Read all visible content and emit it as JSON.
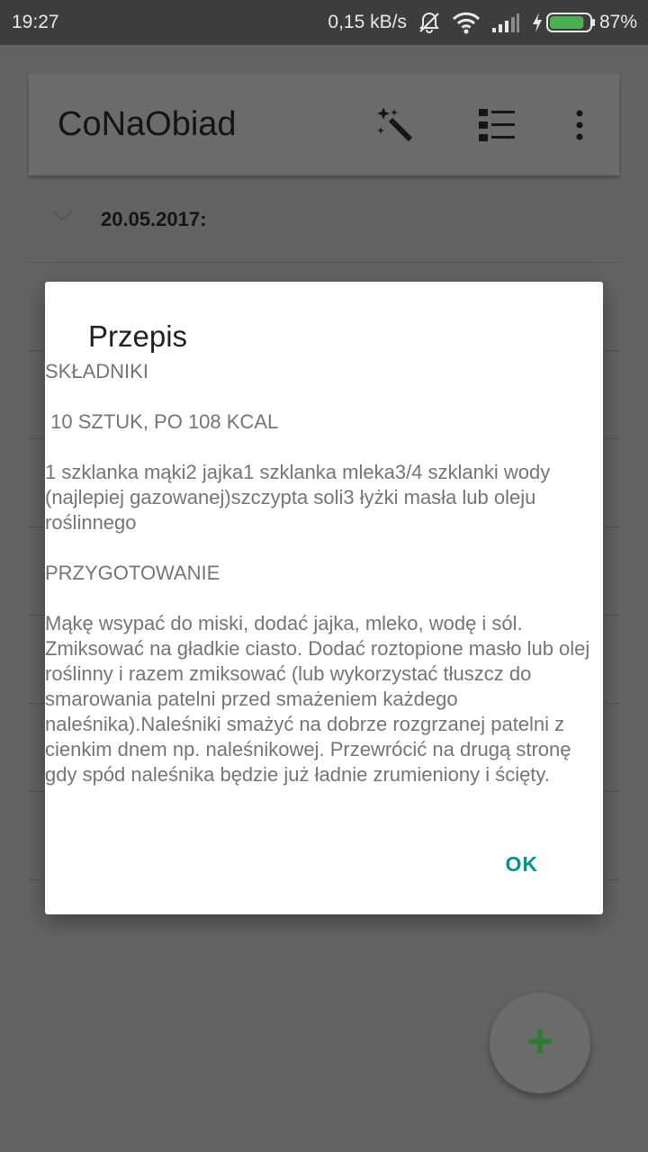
{
  "status_bar": {
    "time": "19:27",
    "net_speed": "0,15 kB/s",
    "battery": "87%",
    "battery_level": 0.87,
    "icons": [
      "muted-notification-icon",
      "wifi-icon",
      "signal-icon",
      "charging-icon",
      "battery-icon"
    ]
  },
  "app": {
    "title": "CoNaObiad",
    "toolbar_icons": [
      "magic-wand-icon",
      "list-view-icon",
      "more-vert-icon"
    ],
    "list": [
      {
        "date": "20.05.2017:"
      }
    ],
    "fab_icon": "plus-icon"
  },
  "dialog": {
    "title": "Przepis",
    "body": "SKŁADNIKI\n\n 10 SZTUK, PO 108 KCAL\n\n1 szklanka mąki2 jajka1 szklanka mleka3/4 szklanki wody (najlepiej gazowanej)szczypta soli3 łyżki masła lub oleju roślinnego\n\nPRZYGOTOWANIE\n\nMąkę wsypać do miski, dodać jajka, mleko, wodę i sól. Zmiksować na gładkie ciasto. Dodać roztopione masło lub olej roślinny i razem zmiksować (lub wykorzystać tłuszcz do smarowania patelni przed smażeniem każdego naleśnika).Naleśniki smażyć na dobrze rozgrzanej patelni z cienkim dnem np. naleśnikowej. Przewrócić na drugą stronę gdy spód naleśnika będzie już ładnie zrumieniony i ścięty.",
    "ok_label": "OK"
  },
  "colors": {
    "accent": "#009688",
    "fab_plus": "#2e7d32",
    "scrim": "#616161",
    "battery_fill": "#4caf50"
  }
}
